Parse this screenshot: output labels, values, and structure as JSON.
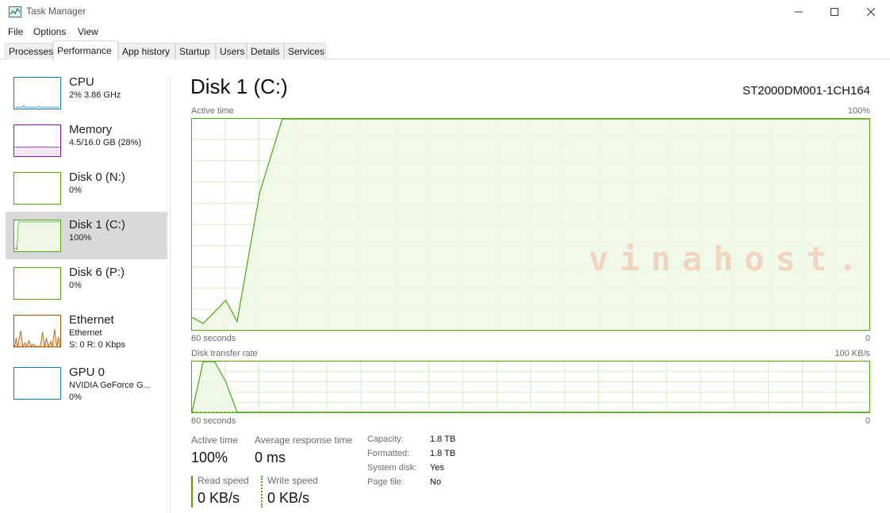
{
  "window": {
    "title": "Task Manager",
    "controls": [
      "minimize-icon",
      "maximize-icon",
      "close-icon"
    ]
  },
  "menu": {
    "file": "File",
    "options": "Options",
    "view": "View"
  },
  "tabs": [
    {
      "label": "Processes",
      "active": false
    },
    {
      "label": "Performance",
      "active": true
    },
    {
      "label": "App history",
      "active": false
    },
    {
      "label": "Startup",
      "active": false
    },
    {
      "label": "Users",
      "active": false
    },
    {
      "label": "Details",
      "active": false
    },
    {
      "label": "Services",
      "active": false
    }
  ],
  "sidebar": {
    "items": [
      {
        "name": "CPU",
        "sub1": "2%  3.86 GHz",
        "color": "#117dbb",
        "selected": false
      },
      {
        "name": "Memory",
        "sub1": "4.5/16.0 GB (28%)",
        "color": "#8b12ae",
        "selected": false
      },
      {
        "name": "Disk 0 (N:)",
        "sub1": "0%",
        "color": "#4da60c",
        "selected": false
      },
      {
        "name": "Disk 1 (C:)",
        "sub1": "100%",
        "color": "#4da60c",
        "selected": true
      },
      {
        "name": "Disk 6 (P:)",
        "sub1": "0%",
        "color": "#4da60c",
        "selected": false
      },
      {
        "name": "Ethernet",
        "sub1": "Ethernet",
        "sub2": "S: 0 R: 0 Kbps",
        "color": "#a74f01",
        "selected": false
      },
      {
        "name": "GPU 0",
        "sub1": "NVIDIA GeForce G...",
        "sub2": "0%",
        "color": "#117dbb",
        "selected": false
      }
    ]
  },
  "disk": {
    "title": "Disk 1 (C:)",
    "model": "ST2000DM001-1CH164",
    "accent": "#4da60c",
    "fill": "#eef7e6",
    "active_time_chart": {
      "label": "Active time",
      "max_label": "100%",
      "time_label": "60 seconds",
      "min_label": "0"
    },
    "transfer_chart": {
      "label": "Disk transfer rate",
      "max_label": "100 KB/s",
      "time_label": "60 seconds",
      "min_label": "0"
    },
    "stats": {
      "active_time_label": "Active time",
      "active_time_value": "100%",
      "avg_response_label": "Average response time",
      "avg_response_value": "0 ms",
      "read_speed_label": "Read speed",
      "read_speed_value": "0 KB/s",
      "write_speed_label": "Write speed",
      "write_speed_value": "0 KB/s"
    },
    "properties": [
      {
        "key": "Capacity:",
        "value": "1.8 TB"
      },
      {
        "key": "Formatted:",
        "value": "1.8 TB"
      },
      {
        "key": "System disk:",
        "value": "Yes"
      },
      {
        "key": "Page file:",
        "value": "No"
      }
    ]
  },
  "watermark": "vinahost.",
  "chart_data": [
    {
      "type": "line",
      "title": "Active time",
      "xlabel": "60 seconds",
      "ylabel": "",
      "ylim": [
        0,
        100
      ],
      "x": [
        60,
        59,
        57,
        56,
        54,
        52,
        51,
        0
      ],
      "series": [
        {
          "values": [
            6,
            3,
            14,
            4,
            65,
            100,
            100,
            100
          ]
        }
      ]
    },
    {
      "type": "line",
      "title": "Disk transfer rate",
      "xlabel": "60 seconds",
      "ylabel": "",
      "ylim": [
        0,
        100
      ],
      "x": [
        60,
        59,
        58,
        57,
        56,
        55,
        54,
        53,
        52,
        51,
        50,
        49,
        48,
        47,
        46,
        45,
        44,
        43,
        42,
        41,
        40,
        39,
        38,
        37,
        36,
        35,
        34,
        33,
        32,
        31,
        30,
        29,
        28,
        27,
        26,
        25,
        24,
        23,
        22,
        21,
        20,
        19,
        18,
        17,
        16,
        15,
        14,
        13,
        12,
        11,
        10,
        9,
        8,
        7,
        6,
        5,
        4,
        3,
        2,
        1,
        0
      ],
      "series": [
        {
          "values": [
            0,
            100,
            100,
            60,
            0,
            0,
            0,
            0,
            0,
            0,
            0,
            0,
            0,
            0,
            0,
            0,
            0,
            0,
            0,
            0,
            0,
            0,
            0,
            0,
            0,
            0,
            0,
            0,
            0,
            0,
            0,
            0,
            0,
            0,
            0,
            0,
            0,
            0,
            0,
            0,
            0,
            0,
            0,
            0,
            0,
            0,
            0,
            0,
            0,
            0,
            0,
            0,
            0,
            0,
            0,
            0,
            0,
            0,
            0,
            0,
            0
          ]
        },
        {
          "values": [
            0,
            0,
            0,
            0,
            0,
            0,
            0,
            0,
            0,
            0,
            0,
            0,
            0,
            0,
            0,
            0,
            0,
            0,
            0,
            0,
            0,
            0,
            0,
            0,
            0,
            0,
            0,
            0,
            0,
            0,
            0,
            0,
            0,
            0,
            0,
            0,
            0,
            0,
            0,
            0,
            0,
            0,
            0,
            0,
            0,
            0,
            0,
            0,
            0,
            0,
            0,
            0,
            0,
            0,
            0,
            0,
            0,
            0,
            0,
            0,
            0
          ]
        }
      ]
    }
  ]
}
